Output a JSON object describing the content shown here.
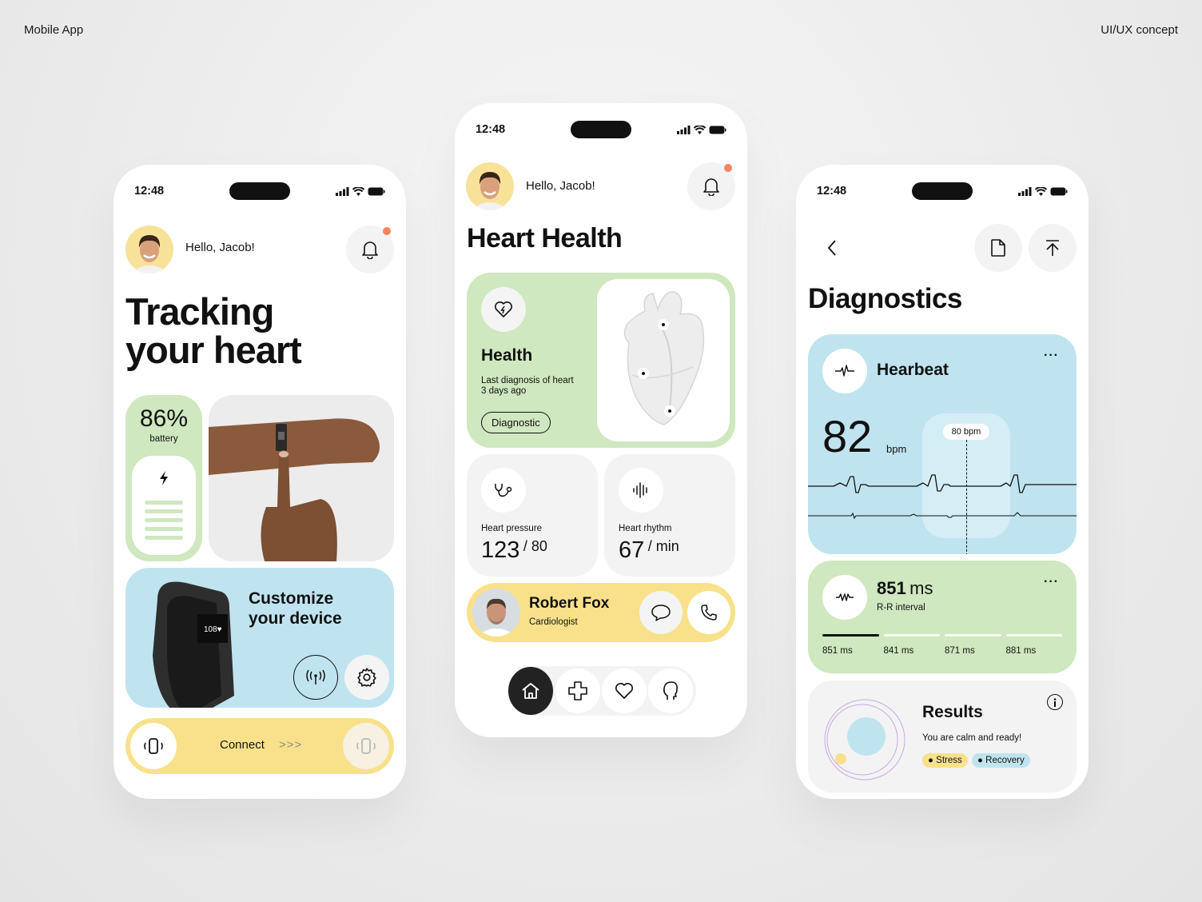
{
  "corner_left": "Mobile App",
  "corner_right": "UI/UX concept",
  "colors": {
    "green": "#cfe8bf",
    "blue": "#bfe4ef",
    "yellow": "#f8e18a",
    "gray": "#f3f3f3",
    "notify": "#f4845f"
  },
  "phone1": {
    "status_time": "12:48",
    "greeting": "Hello, Jacob!",
    "title_line1": "Tracking",
    "title_line2": "your heart",
    "battery_value": "86%",
    "battery_label": "battery",
    "customize_line1": "Customize",
    "customize_line2": "your device",
    "connect_label": "Connect",
    "connect_arrows": ">>>"
  },
  "phone2": {
    "status_time": "12:48",
    "greeting": "Hello, Jacob!",
    "title": "Heart Health",
    "health_title": "Health",
    "health_desc_1": "Last diagnosis of heart",
    "health_desc_2": "3 days ago",
    "diagnostic_button": "Diagnostic",
    "pressure_label": "Heart pressure",
    "pressure_value": "123",
    "pressure_unit": "/ 80",
    "rhythm_label": "Heart rhythm",
    "rhythm_value": "67",
    "rhythm_unit": "/ min",
    "doctor_name": "Robert Fox",
    "doctor_role": "Cardiologist",
    "nav": [
      "home-icon",
      "plus-icon",
      "heart-icon",
      "head-icon"
    ]
  },
  "phone3": {
    "status_time": "12:48",
    "title": "Diagnostics",
    "heartbeat_title": "Hearbeat",
    "bpm_value": "82",
    "bpm_unit": "bpm",
    "tooltip": "80 bpm",
    "rr_value": "851",
    "rr_unit": "ms",
    "rr_label": "R-R interval",
    "rr_items": [
      "851 ms",
      "841 ms",
      "871 ms",
      "881 ms"
    ],
    "rr_active_index": 0,
    "results_title": "Results",
    "results_desc": "You are calm and ready!",
    "tag_stress": "Stress",
    "tag_recovery": "Recovery"
  }
}
